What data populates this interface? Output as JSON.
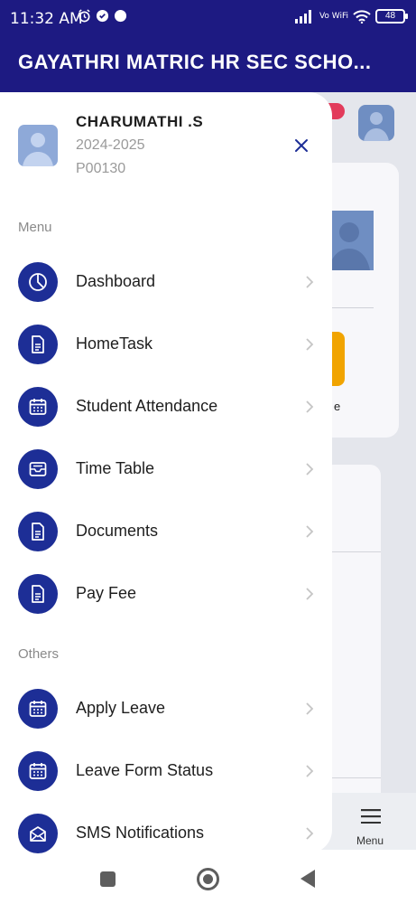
{
  "status_bar": {
    "time": "11:32 AM",
    "network": "Vo WiFi",
    "battery": "48"
  },
  "app_bar": {
    "title": "GAYATHRI MATRIC HR SEC SCHO..."
  },
  "profile": {
    "name": "CHARUMATHI .S",
    "academic_year": "2024-2025",
    "student_id": "P00130"
  },
  "sections": {
    "menu_label": "Menu",
    "others_label": "Others"
  },
  "menu_items": [
    {
      "label": "Dashboard",
      "icon": "clock-pie-icon"
    },
    {
      "label": "HomeTask",
      "icon": "document-icon"
    },
    {
      "label": "Student Attendance",
      "icon": "calendar-icon"
    },
    {
      "label": "Time Table",
      "icon": "inbox-tray-icon"
    },
    {
      "label": "Documents",
      "icon": "document-icon"
    },
    {
      "label": "Pay Fee",
      "icon": "document-icon"
    }
  ],
  "other_items": [
    {
      "label": "Apply Leave",
      "icon": "calendar-icon"
    },
    {
      "label": "Leave Form Status",
      "icon": "calendar-icon"
    },
    {
      "label": "SMS Notifications",
      "icon": "envelope-icon"
    }
  ],
  "background": {
    "fragment_text": "e",
    "bottom_nav_label": "Menu"
  },
  "colors": {
    "primary": "#1d1a82",
    "icon_circle": "#1d2e96",
    "badge": "#e23b5b",
    "accent_orange": "#f1a400"
  }
}
